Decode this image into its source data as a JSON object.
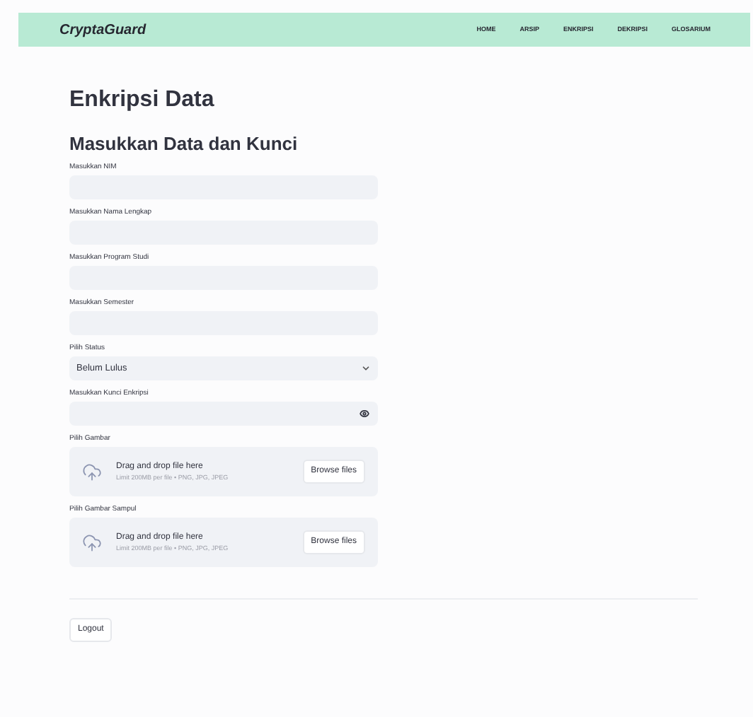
{
  "navbar": {
    "brand": "CryptaGuard",
    "links": [
      "HOME",
      "ARSIP",
      "ENKRIPSI",
      "DEKRIPSI",
      "GLOSARIUM"
    ]
  },
  "title": "Enkripsi Data",
  "subtitle": "Masukkan Data dan Kunci",
  "fields": [
    {
      "kind": "text",
      "label": "Masukkan NIM"
    },
    {
      "kind": "text",
      "label": "Masukkan Nama Lengkap"
    },
    {
      "kind": "text",
      "label": "Masukkan Program Studi"
    },
    {
      "kind": "text",
      "label": "Masukkan Semester"
    },
    {
      "kind": "select",
      "label": "Pilih Status",
      "value": "Belum Lulus"
    },
    {
      "kind": "password",
      "label": "Masukkan Kunci Enkripsi"
    },
    {
      "kind": "upload",
      "label": "Pilih Gambar",
      "prompt": "Drag and drop file here",
      "limit": "Limit 200MB per file • PNG, JPG, JPEG",
      "button": "Browse files"
    },
    {
      "kind": "upload",
      "label": "Pilih Gambar Sampul",
      "prompt": "Drag and drop file here",
      "limit": "Limit 200MB per file • PNG, JPG, JPEG",
      "button": "Browse files"
    }
  ],
  "logout": "Logout"
}
